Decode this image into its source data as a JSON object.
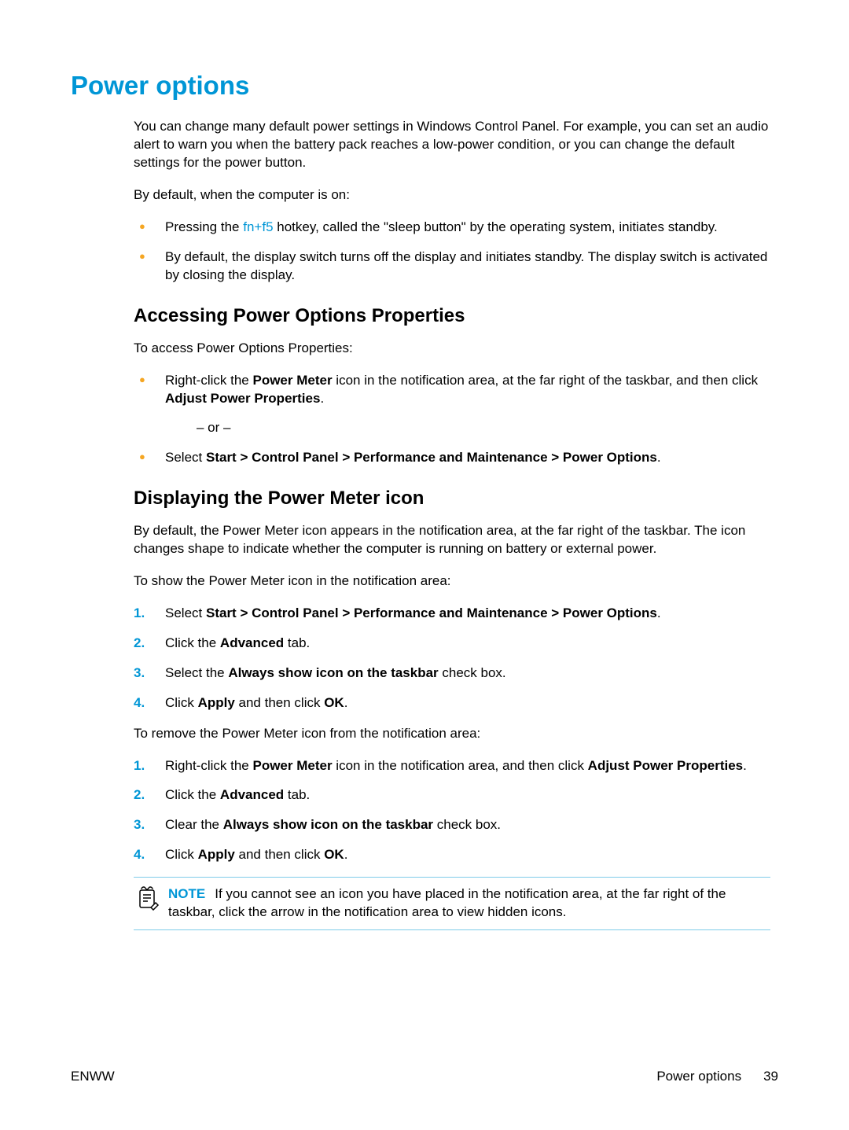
{
  "title": "Power options",
  "intro": "You can change many default power settings in Windows Control Panel. For example, you can set an audio alert to warn you when the battery pack reaches a low-power condition, or you can change the default settings for the power button.",
  "by_default_on": "By default, when the computer is on:",
  "bullets_on": {
    "b0_pre": "Pressing the ",
    "b0_link": "fn+f5",
    "b0_post": " hotkey, called the \"sleep button\" by the operating system, initiates standby.",
    "b1": "By default, the display switch turns off the display and initiates standby. The display switch is activated by closing the display."
  },
  "sec_access_title": "Accessing Power Options Properties",
  "sec_access_intro": "To access Power Options Properties:",
  "access_bullets": {
    "b0_pre": "Right-click the ",
    "b0_bold1": "Power Meter",
    "b0_mid": " icon in the notification area, at the far right of the taskbar, and then click ",
    "b0_bold2": "Adjust Power Properties",
    "b0_post": ".",
    "or": "– or –",
    "b1_pre": "Select ",
    "b1_bold": "Start > Control Panel > Performance and Maintenance > Power Options",
    "b1_post": "."
  },
  "sec_icon_title": "Displaying the Power Meter icon",
  "sec_icon_intro": "By default, the Power Meter icon appears in the notification area, at the far right of the taskbar. The icon changes shape to indicate whether the computer is running on battery or external power.",
  "show_intro": "To show the Power Meter icon in the notification area:",
  "show_steps": {
    "s1_pre": "Select ",
    "s1_bold": "Start > Control Panel > Performance and Maintenance > Power Options",
    "s1_post": ".",
    "s2_pre": "Click the ",
    "s2_bold": "Advanced",
    "s2_post": " tab.",
    "s3_pre": "Select the ",
    "s3_bold": "Always show icon on the taskbar",
    "s3_post": " check box.",
    "s4_pre": "Click ",
    "s4_bold1": "Apply",
    "s4_mid": " and then click ",
    "s4_bold2": "OK",
    "s4_post": "."
  },
  "remove_intro": "To remove the Power Meter icon from the notification area:",
  "remove_steps": {
    "s1_pre": "Right-click the ",
    "s1_bold1": "Power Meter",
    "s1_mid": " icon in the notification area, and then click ",
    "s1_bold2": "Adjust Power Properties",
    "s1_post": ".",
    "s2_pre": "Click the ",
    "s2_bold": "Advanced",
    "s2_post": " tab.",
    "s3_pre": "Clear the ",
    "s3_bold": "Always show icon on the taskbar",
    "s3_post": " check box.",
    "s4_pre": "Click ",
    "s4_bold1": "Apply",
    "s4_mid": " and then click ",
    "s4_bold2": "OK",
    "s4_post": "."
  },
  "note_label": "NOTE",
  "note_text": "If you cannot see an icon you have placed in the notification area, at the far right of the taskbar, click the arrow in the notification area to view hidden icons.",
  "footer_left": "ENWW",
  "footer_section": "Power options",
  "footer_page": "39"
}
